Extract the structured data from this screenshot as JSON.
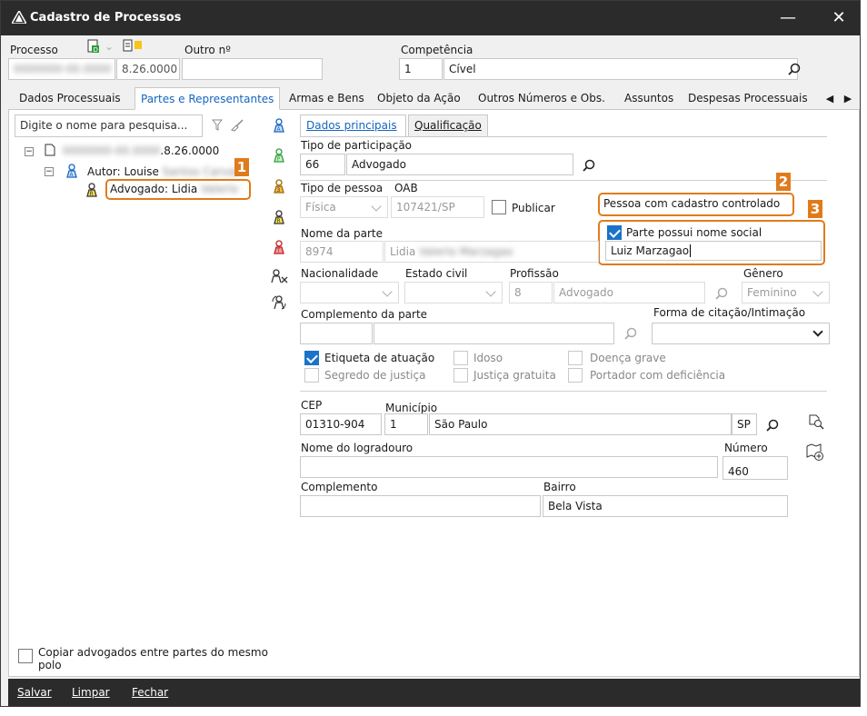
{
  "window": {
    "title": "Cadastro de Processos",
    "minimize": "—",
    "close": "✕"
  },
  "header": {
    "processo_label": "Processo",
    "processo_prefix": "0000000-00.0000",
    "processo_suffix": "8.26.0000",
    "outro_label": "Outro nº",
    "outro_value": "",
    "competencia_label": "Competência",
    "competencia_code": "1",
    "competencia_name": "Cível"
  },
  "tabs": [
    {
      "label": "Dados Processuais"
    },
    {
      "label": "Partes e Representantes"
    },
    {
      "label": "Armas e Bens"
    },
    {
      "label": "Objeto da Ação"
    },
    {
      "label": "Outros Números e Obs."
    },
    {
      "label": "Assuntos"
    },
    {
      "label": "Despesas Processuais"
    }
  ],
  "tree": {
    "search_placeholder": "Digite o nome para pesquisa...",
    "root_prefix": "0000000-00.0000",
    "root_suffix": ".8.26.0000",
    "autor_label": "Autor: Louise",
    "autor_blur": "Santos Carval",
    "advogado_label": "Advogado: Lidia",
    "advogado_blur": "Valerio"
  },
  "subtabs": {
    "principal": "Dados principais",
    "qualificacao": "Qualificação"
  },
  "form": {
    "tipo_participacao_label": "Tipo de participação",
    "tipo_participacao_code": "66",
    "tipo_participacao_name": "Advogado",
    "tipo_pessoa_label": "Tipo de pessoa",
    "tipo_pessoa_value": "Física",
    "oab_label": "OAB",
    "oab_value": "107421/SP",
    "publicar_label": "Publicar",
    "cadastro_controlado": "Pessoa com cadastro controlado",
    "nome_social_label": "Parte possui nome social",
    "nome_social_value": "Luiz Marzagao",
    "nome_parte_label": "Nome da parte",
    "nome_parte_code": "8974",
    "nome_parte_first": "Lidia",
    "nome_parte_blur": "Valerio Marzagao",
    "nacionalidade_label": "Nacionalidade",
    "estado_civil_label": "Estado civil",
    "profissao_label": "Profissão",
    "profissao_code": "8",
    "profissao_name": "Advogado",
    "genero_label": "Gênero",
    "genero_value": "Feminino",
    "complemento_parte_label": "Complemento da parte",
    "forma_citacao_label": "Forma de citação/Intimação",
    "etiqueta_label": "Etiqueta de atuação",
    "idoso_label": "Idoso",
    "doenca_label": "Doença grave",
    "segredo_label": "Segredo de justiça",
    "justica_label": "Justiça gratuita",
    "deficiencia_label": "Portador com deficiência",
    "cep_label": "CEP",
    "cep_value": "01310-904",
    "municipio_label": "Município",
    "municipio_code": "1",
    "municipio_name": "São Paulo",
    "uf": "SP",
    "logradouro_label": "Nome do logradouro",
    "logradouro_value": "",
    "numero_label": "Número",
    "numero_value": "460",
    "complemento_label": "Complemento",
    "complemento_value": "",
    "bairro_label": "Bairro",
    "bairro_value": "Bela Vista"
  },
  "copiar_label": "Copiar advogados entre partes do mesmo polo",
  "footer": {
    "salvar": "Salvar",
    "limpar": "Limpar",
    "fechar": "Fechar"
  },
  "callouts": {
    "one": "1",
    "two": "2",
    "three": "3"
  },
  "colors": {
    "accent": "#1565c0",
    "highlight": "#e07b1c",
    "titlebar": "#2b2b2b"
  }
}
